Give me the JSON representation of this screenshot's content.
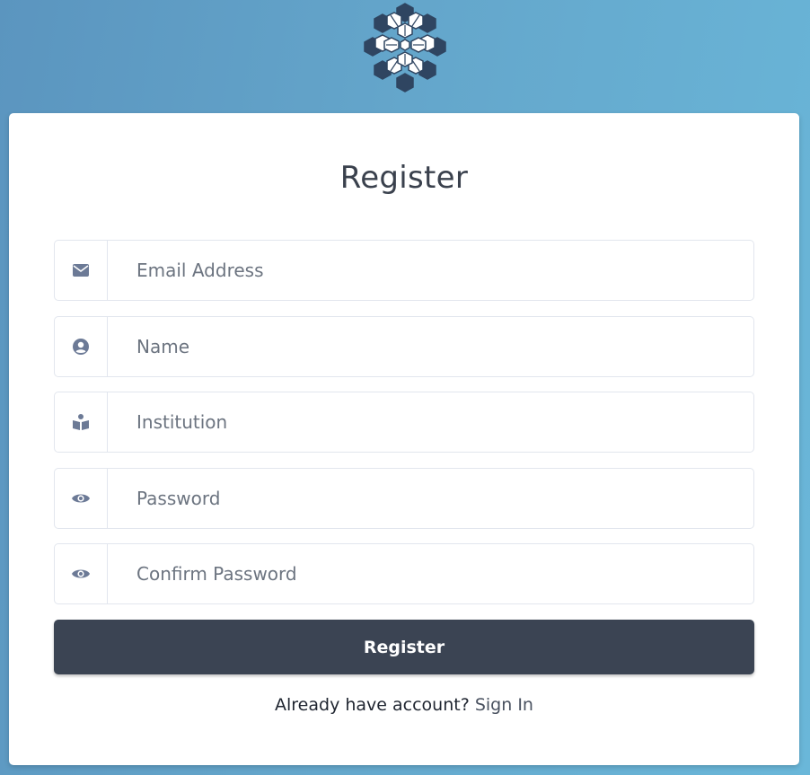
{
  "logo": {
    "icon": "hexagon-flower-logo",
    "dark_color": "#2f4561",
    "light_color": "#ffffff"
  },
  "form": {
    "title": "Register",
    "fields": [
      {
        "icon": "envelope-icon",
        "placeholder": "Email Address",
        "value": ""
      },
      {
        "icon": "user-circle-icon",
        "placeholder": "Name",
        "value": ""
      },
      {
        "icon": "book-reader-icon",
        "placeholder": "Institution",
        "value": ""
      },
      {
        "icon": "eye-icon",
        "placeholder": "Password",
        "value": ""
      },
      {
        "icon": "eye-icon",
        "placeholder": "Confirm Password",
        "value": ""
      }
    ],
    "submit_label": "Register",
    "signin_prompt": "Already have account?",
    "signin_link": "Sign In"
  },
  "colors": {
    "button": "#3b4453",
    "icon": "#6c7a96",
    "background_start": "#5b95bf",
    "background_end": "#6ab7d9"
  }
}
